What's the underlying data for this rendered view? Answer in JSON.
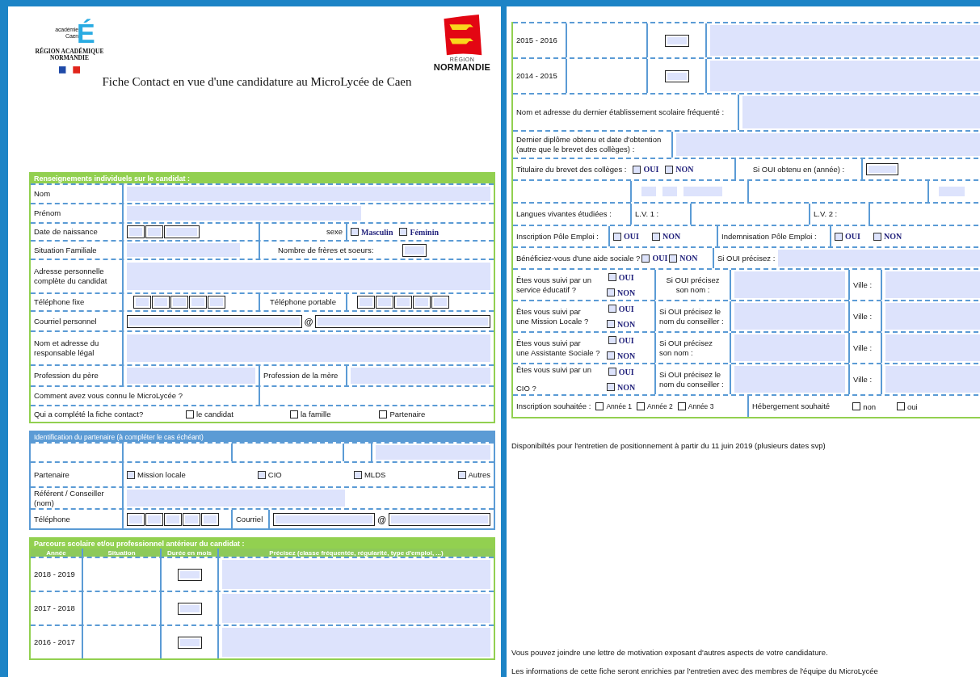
{
  "header": {
    "academy_logo": {
      "name_lines": [
        "académie",
        "Caen"
      ],
      "letter": "É",
      "region_lines": [
        "RÉGION ACADÉMIQUE",
        "NORMANDIE"
      ]
    },
    "region_logo": {
      "small": "RÉGION",
      "big": "NORMANDIE"
    },
    "title": "Fiche Contact en vue d'une candidature au MicroLycée de Caen"
  },
  "candidate": {
    "title": "Renseignements individuels sur le candidat :",
    "nom": "Nom",
    "prenom": "Prénom",
    "birth_date": "Date de naissance",
    "sex_label": "sexe",
    "sex_options": [
      {
        "label": "Masculin",
        "checked": false
      },
      {
        "label": "Féminin",
        "checked": false
      }
    ],
    "family_situation": "Situation Familiale",
    "siblings": "Nombre de frères et soeurs:",
    "address": "Adresse personnelle\ncomplète du candidat",
    "phone": "Téléphone fixe",
    "mobile": "Téléphone portable",
    "email": "Courriel personnel",
    "at": "@",
    "guardian": "Nom et adresse du\nresponsable légal",
    "father_job": "Profession du père",
    "mother_job": "Profession de la mère",
    "how_known": "Comment avez vous connu le MicroLycée ?",
    "filled_by": "Qui a complété la fiche contact?",
    "filled_by_options": [
      {
        "label": "le candidat",
        "checked": false
      },
      {
        "label": "la famille",
        "checked": false
      },
      {
        "label": "Partenaire",
        "checked": false
      }
    ]
  },
  "partner": {
    "title": "Identification du partenaire (à compléter le cas échéant)",
    "type_label": "Partenaire",
    "types": [
      {
        "label": "Mission locale",
        "checked": false
      },
      {
        "label": "CIO",
        "checked": false
      },
      {
        "label": "MLDS",
        "checked": false
      },
      {
        "label": "Autres",
        "checked": false
      }
    ],
    "referent": "Référent / Conseiller\n(nom)",
    "phone": "Téléphone",
    "email": "Courriel",
    "at": "@"
  },
  "history": {
    "title": "Parcours scolaire et/ou professionnel antérieur du candidat :",
    "columns": [
      "Année",
      "Situation",
      "Durée en mois",
      "Précisez (classe fréquentée, régularité,  type d'emploi, ...)"
    ],
    "rows": [
      "2018 - 2019",
      "2017 - 2018",
      "2016 - 2017"
    ],
    "rows_continued": [
      "2015 - 2016",
      "2014 - 2015"
    ]
  },
  "schooling": {
    "last_school": "Nom et adresse du dernier établissement scolaire fréquenté :",
    "last_diploma": "Dernier diplôme obtenu et date d'obtention\n(autre que le brevet des collèges) :",
    "brevet": "Titulaire du brevet des collèges :",
    "brevet_options": [
      {
        "label": "OUI",
        "checked": false
      },
      {
        "label": "NON",
        "checked": false
      }
    ],
    "brevet_year": "Si OUI obtenu en (année) :",
    "languages": "Langues vivantes étudiées :",
    "lv1": "L.V. 1 :",
    "lv2": "L.V. 2 :"
  },
  "employment": {
    "registration": "Inscription Pôle Emploi :",
    "registration_options": [
      {
        "label": "OUI",
        "checked": false
      },
      {
        "label": "NON",
        "checked": false
      }
    ],
    "compensation": "Indemnisation Pôle Emploi :",
    "compensation_options": [
      {
        "label": "OUI",
        "checked": false
      },
      {
        "label": "NON",
        "checked": false
      }
    ]
  },
  "social_aid": {
    "question": "Bénéficiez-vous d'une aide sociale ?",
    "options": [
      {
        "label": "OUI",
        "checked": false
      },
      {
        "label": "NON",
        "checked": false
      }
    ],
    "detail": "Si OUI précisez :"
  },
  "followups": [
    {
      "question": "Êtes vous suivi par un\nservice éducatif ?",
      "options": [
        {
          "label": "OUI",
          "checked": false
        },
        {
          "label": "NON",
          "checked": false
        }
      ],
      "detail": "Si OUI précisez\nson nom :",
      "city": "Ville :"
    },
    {
      "question": "Êtes vous suivi par\nune Mission Locale ?",
      "options": [
        {
          "label": "OUI",
          "checked": false
        },
        {
          "label": "NON",
          "checked": false
        }
      ],
      "detail": "Si OUI précisez le\nnom du conseiller :",
      "city": "Ville :"
    },
    {
      "question": "Êtes vous suivi par\nune Assistante Sociale ?",
      "options": [
        {
          "label": "OUI",
          "checked": false
        },
        {
          "label": "NON",
          "checked": false
        }
      ],
      "detail": "Si OUI précisez\nson nom :",
      "city": "Ville :"
    },
    {
      "question": "Êtes vous suivi par un\n\nCIO ?",
      "options": [
        {
          "label": "OUI",
          "checked": false
        },
        {
          "label": "NON",
          "checked": false
        }
      ],
      "detail": "Si OUI précisez le\nnom du conseiller :",
      "city": "Ville :"
    }
  ],
  "enrollment": {
    "label": "Inscription souhaitée :",
    "years": [
      {
        "label": "Année 1",
        "checked": false
      },
      {
        "label": "Année 2",
        "checked": false
      },
      {
        "label": "Année 3",
        "checked": false
      }
    ],
    "housing": "Hébergement souhaité",
    "housing_options": [
      {
        "label": "non",
        "checked": false
      },
      {
        "label": "oui",
        "checked": false
      }
    ]
  },
  "availability": "Disponibiltés pour l'entretien de positionnement à partir du 11 juin 2019 (plusieurs dates svp)",
  "notes": [
    "Vous pouvez joindre une lettre de motivation exposant d'autres aspects de votre candidature.",
    "Les informations de cette fiche seront enrichies par l'entretien avec des membres de l'équipe du MicroLycée"
  ]
}
